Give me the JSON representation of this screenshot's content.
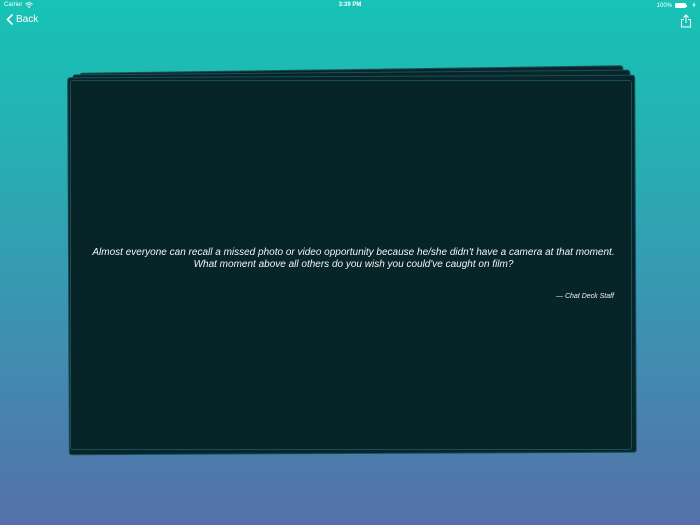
{
  "status_bar": {
    "carrier": "Carrier",
    "time": "3:39 PM",
    "battery": "100%",
    "battery_level": 1.0,
    "icons": [
      "wifi-icon",
      "battery-icon",
      "charging-icon"
    ]
  },
  "nav": {
    "back_label": "Back",
    "back_icon": "chevron-left-icon",
    "share_icon": "share-icon"
  },
  "card": {
    "question": "Almost everyone can recall a missed photo or video opportunity because he/she didn't have a camera at that moment. What moment above all others do you wish you could've caught on film?",
    "attribution": "— Chat Deck Staff"
  },
  "colors": {
    "gradient_top": "#17c3b5",
    "gradient_bottom": "#5470aa",
    "card_background": "#072429",
    "card_border": "#1c4f55",
    "text": "#ffffff"
  }
}
